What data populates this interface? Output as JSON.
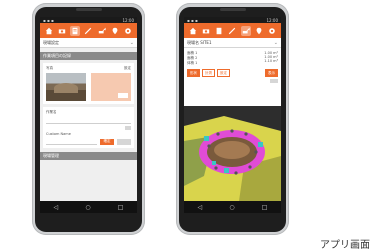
{
  "caption": "アプリ画面",
  "status_bar": {
    "time": "12:00"
  },
  "left_screen": {
    "subbar_label": "現場設定",
    "section_title": "作業項目の記録",
    "photo_label": "写真",
    "settings_label": "設定",
    "field_label": "作業名",
    "sub_field_label": "Custom Name",
    "confirm_button": "確定",
    "footer_section": "現場管理"
  },
  "right_screen": {
    "subbar_label": "現場名 SITE1",
    "row_labels": [
      "面積 1",
      "面積 2",
      "体積 1"
    ],
    "row_values": [
      "1.00 m²",
      "1.00 m²",
      "1.10 m³"
    ],
    "tags": [
      "形状",
      "計測",
      "設定"
    ],
    "view_button": "表示"
  },
  "navbar": {
    "back": "◁",
    "home": "○",
    "recent": "□"
  },
  "colors": {
    "accent": "#ee6b2c",
    "grey_header": "#8a8a8a",
    "terrain": "#d9d44c",
    "ring": "#e04cd6",
    "marker": "#39c7c4"
  }
}
